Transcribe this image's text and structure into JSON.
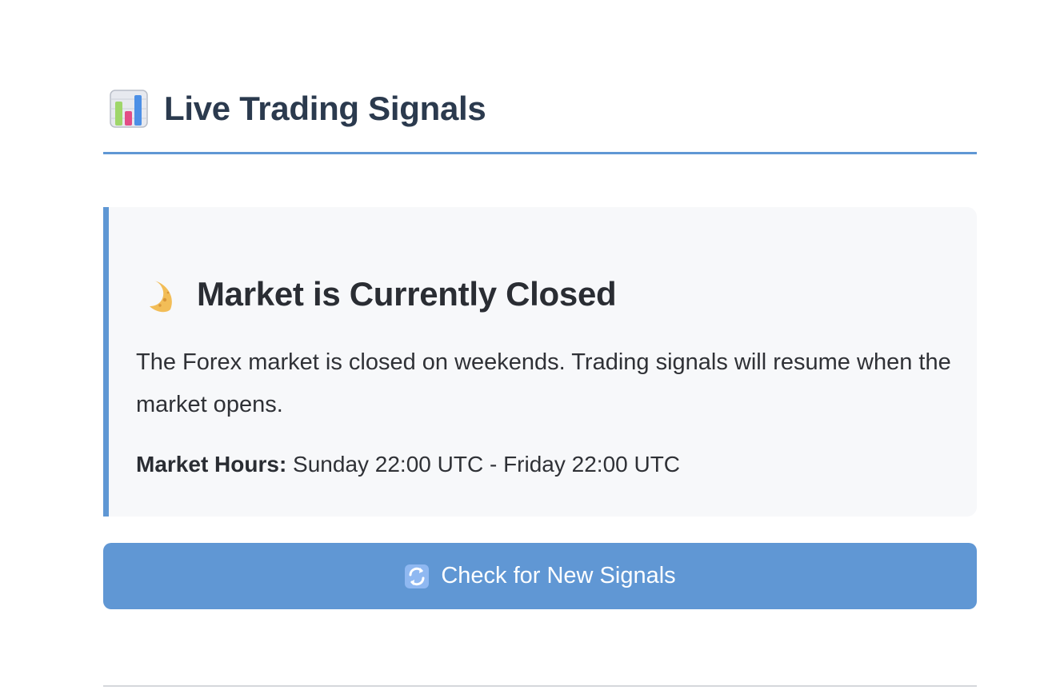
{
  "header": {
    "icon": "bar-chart-icon",
    "title": "Live Trading Signals"
  },
  "market_card": {
    "icon": "crescent-moon-icon",
    "title": "Market is Currently Closed",
    "message": "The Forex market is closed on weekends. Trading signals will resume when the market opens.",
    "hours_label": "Market Hours:",
    "hours_value": "Sunday 22:00 UTC - Friday 22:00 UTC"
  },
  "actions": {
    "refresh_icon": "refresh-icon",
    "refresh_label": "Check for New Signals"
  },
  "colors": {
    "accent": "#5f97d4",
    "card_background": "#f7f8fa",
    "title_text": "#2b3a4e",
    "divider": "#d5d7db"
  }
}
